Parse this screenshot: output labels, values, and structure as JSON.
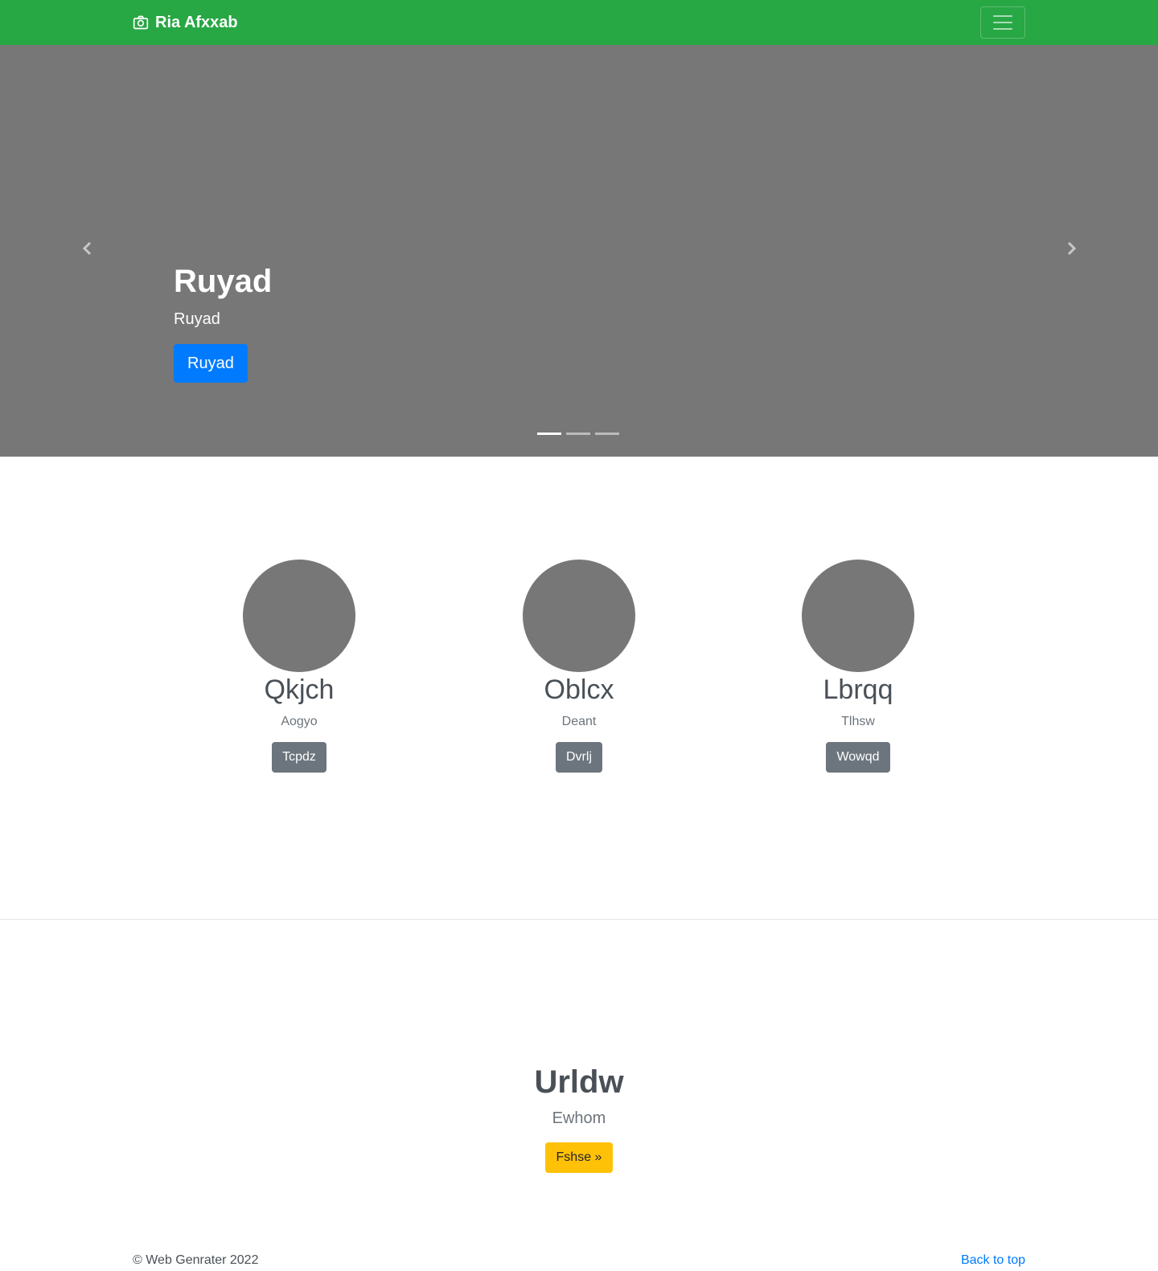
{
  "navbar": {
    "brand": "Ria Afxxab",
    "brand_icon": "camera-icon",
    "toggler_icon": "hamburger-icon",
    "bg_color": "#28a745"
  },
  "carousel": {
    "heading": "Ruyad",
    "subheading": "Ruyad",
    "button_label": "Ruyad",
    "prev_icon": "chevron-left-icon",
    "next_icon": "chevron-right-icon",
    "slide_count": 3,
    "active_slide": 1,
    "bg_color": "#777777"
  },
  "columns": [
    {
      "title": "Qkjch",
      "text": "Aogyo",
      "button": "Tcpdz"
    },
    {
      "title": "Oblcx",
      "text": "Deant",
      "button": "Dvrlj"
    },
    {
      "title": "Lbrqq",
      "text": "Tlhsw",
      "button": "Wowqd"
    }
  ],
  "featurette": {
    "heading": "Urldw",
    "lead": "Ewhom",
    "button": "Fshse »"
  },
  "footer": {
    "copyright": "© Web Genrater 2022",
    "back_to_top": "Back to top"
  },
  "colors": {
    "primary": "#007bff",
    "secondary": "#6c757d",
    "warning": "#ffc107",
    "success": "#28a745"
  }
}
